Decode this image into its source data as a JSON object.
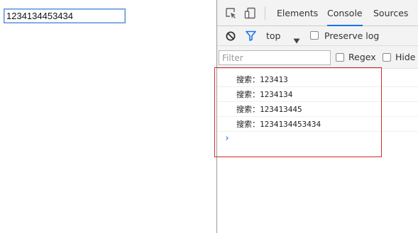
{
  "page": {
    "search_value": "1234134453434"
  },
  "devtools": {
    "tabs": [
      "Elements",
      "Console",
      "Sources"
    ],
    "active_tab": "Console",
    "context_select": "top",
    "preserve_log_label": "Preserve log",
    "filter_placeholder": "Filter",
    "regex_label": "Regex",
    "hide_label": "Hide",
    "console_logs": [
      "搜索：123413",
      "搜索：1234134",
      "搜索：123413445",
      "搜索：1234134453434"
    ],
    "prompt_symbol": "›"
  },
  "colors": {
    "active_tab_underline": "#1a73e8",
    "filter_icon": "#1a73e8",
    "highlight_box": "#d22a2a",
    "prompt": "#3b82f6"
  },
  "icons": [
    "inspect-element-icon",
    "device-toggle-icon",
    "clear-console-icon",
    "filter-funnel-icon",
    "dropdown-arrow-icon",
    "console-prompt-icon"
  ]
}
